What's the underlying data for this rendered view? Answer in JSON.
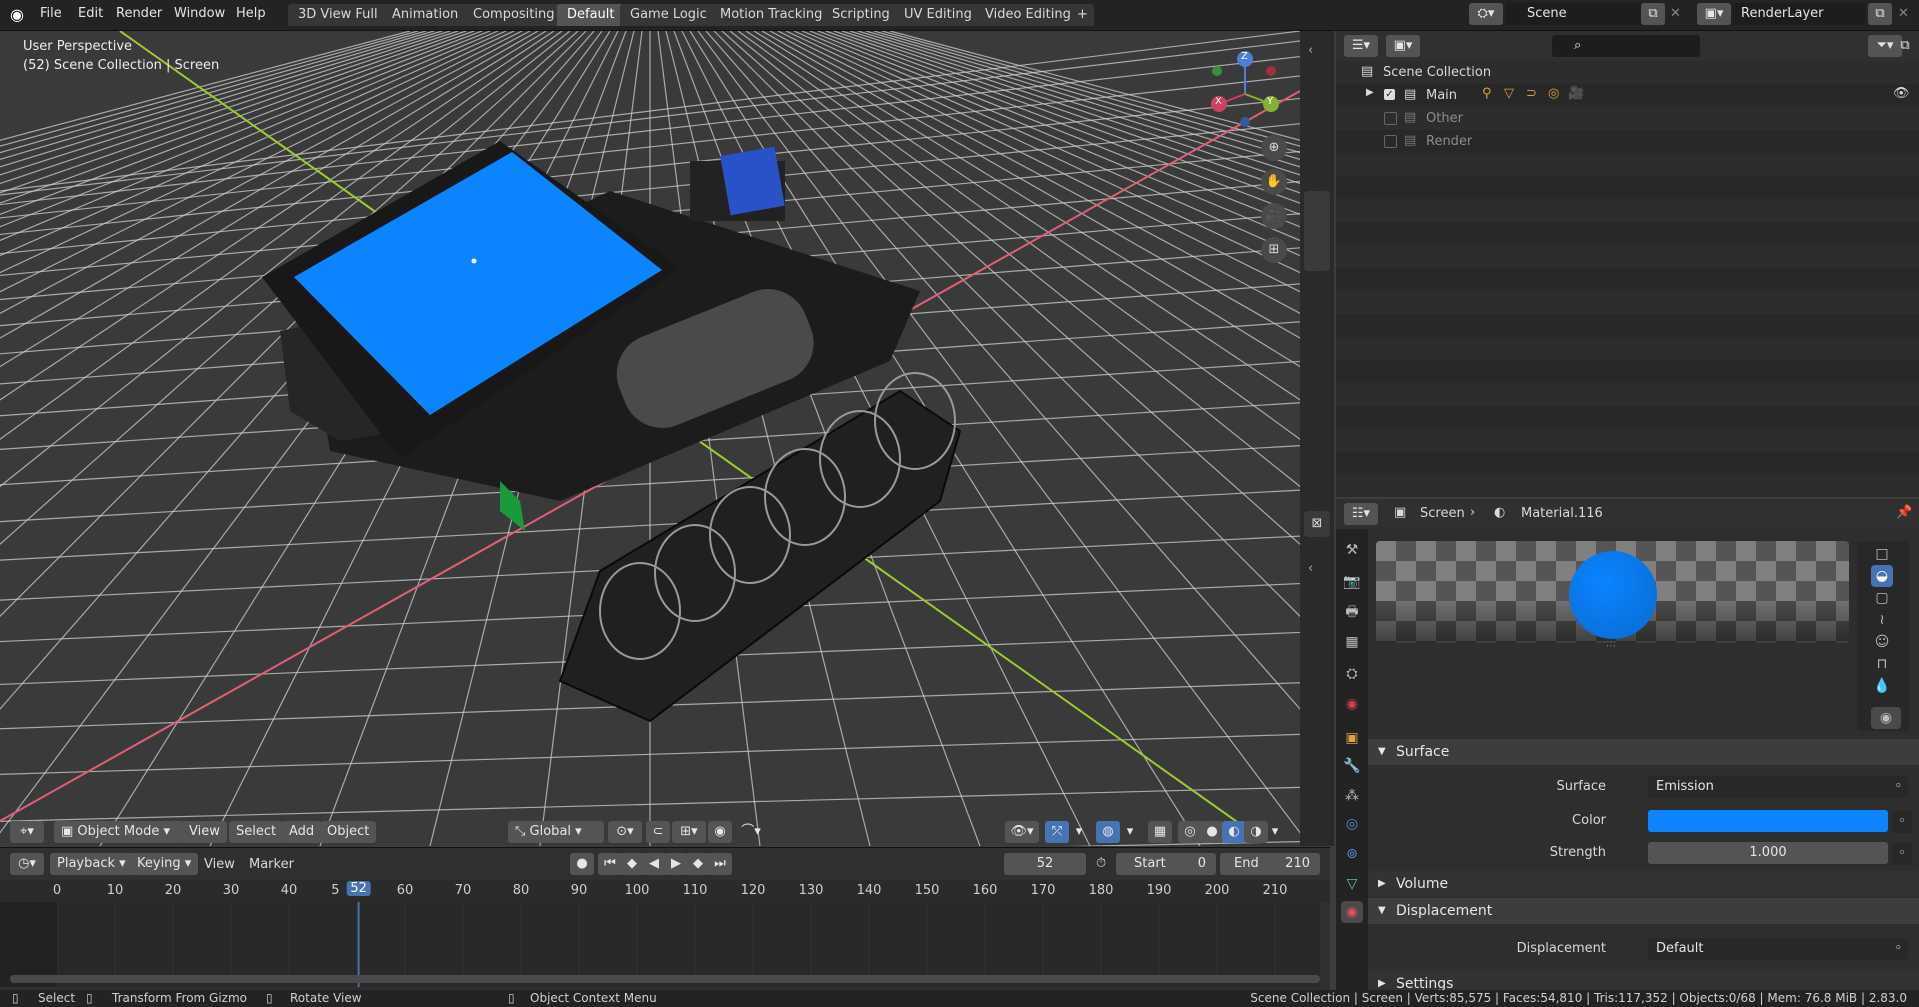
{
  "menu": [
    "File",
    "Edit",
    "Render",
    "Window",
    "Help"
  ],
  "workspaces": [
    "3D View Full",
    "Animation",
    "Compositing",
    "Default",
    "Game Logic",
    "Motion Tracking",
    "Scripting",
    "UV Editing",
    "Video Editing"
  ],
  "workspace_add": "+",
  "scene": "Scene",
  "render_layer": "RenderLayer",
  "viewport": {
    "title": "User Perspective",
    "subtitle": "(52) Scene Collection | Screen",
    "mode": "Object Mode",
    "menus": [
      "View",
      "Select",
      "Add",
      "Object"
    ],
    "orientation": "Global",
    "gizmo": {
      "z": "Z",
      "y": "Y",
      "x": "X"
    },
    "colors": {
      "screen": "#0a84ff",
      "grid": "#cfcfcf",
      "x_axis": "#e06070",
      "y_axis": "#9acd32"
    }
  },
  "timeline": {
    "menus": [
      "Playback",
      "Keying",
      "View",
      "Marker"
    ],
    "current_frame": "52",
    "start_label": "Start",
    "start": "0",
    "end_label": "End",
    "end": "210",
    "ticks": [
      "0",
      "10",
      "20",
      "30",
      "40",
      "5",
      "52",
      "60",
      "70",
      "80",
      "90",
      "100",
      "110",
      "120",
      "130",
      "140",
      "150",
      "160",
      "170",
      "180",
      "190",
      "200",
      "210"
    ],
    "tick_frames": [
      0,
      10,
      20,
      30,
      40,
      48,
      52,
      60,
      70,
      80,
      90,
      100,
      110,
      120,
      130,
      140,
      150,
      160,
      170,
      180,
      190,
      200,
      210
    ]
  },
  "outliner": {
    "root": "Scene Collection",
    "items": [
      {
        "label": "Main",
        "checked": true
      },
      {
        "label": "Other",
        "checked": false
      },
      {
        "label": "Render",
        "checked": false
      }
    ]
  },
  "properties": {
    "breadcrumb_object": "Screen",
    "breadcrumb_material": "Material.116",
    "preview_sphere_color": "#0a84ff",
    "surface_panel": "Surface",
    "surface_label": "Surface",
    "surface_value": "Emission",
    "color_label": "Color",
    "color_value": "#0a84ff",
    "strength_label": "Strength",
    "strength_value": "1.000",
    "volume_panel": "Volume",
    "displacement_panel": "Displacement",
    "displacement_label": "Displacement",
    "displacement_value": "Default",
    "settings_panel": "Settings"
  },
  "status": {
    "select": "Select",
    "transform": "Transform From Gizmo",
    "rotate": "Rotate View",
    "context": "Object Context Menu",
    "stats": "Scene Collection | Screen | Verts:85,575 | Faces:54,810 | Tris:117,352 | Objects:0/68 | Mem: 76.8 MiB | 2.83.0"
  }
}
